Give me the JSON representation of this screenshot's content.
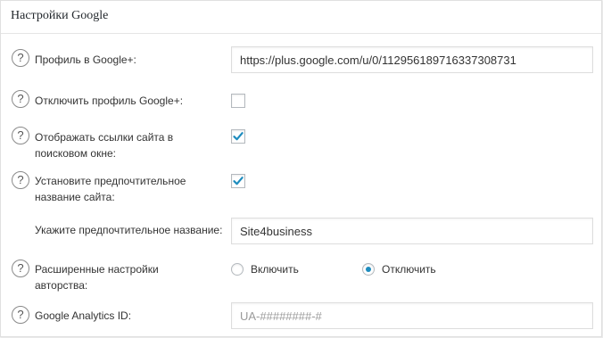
{
  "panel": {
    "title": "Настройки Google"
  },
  "colors": {
    "accent": "#1e8cbe",
    "border": "#dddddd"
  },
  "help_icon": "?",
  "rows": {
    "gplus_profile": {
      "label": "Профиль в Google+:",
      "value": "https://plus.google.com/u/0/112956189716337308731"
    },
    "disable_gplus": {
      "label": "Отключить профиль Google+:",
      "checked": false
    },
    "sitelinks_searchbox": {
      "label": "Отображать ссылки сайта в поисковом окне:",
      "checked": true
    },
    "preferred_name": {
      "label": "Установите предпочтительное название сайта:",
      "checked": true,
      "sub_label": "Укажите предпочтительное название:",
      "sub_value": "Site4business"
    },
    "authorship": {
      "label": "Расширенные настройки авторства:",
      "options": [
        "Включить",
        "Отключить"
      ],
      "selected": "Отключить"
    },
    "analytics": {
      "label": "Google Analytics ID:",
      "value": "",
      "placeholder": "UA-########-#"
    }
  }
}
